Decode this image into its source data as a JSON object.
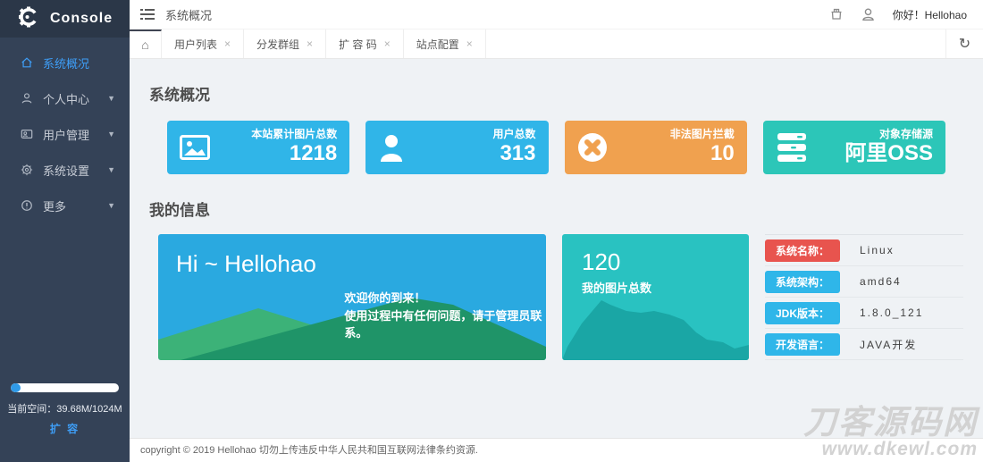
{
  "app": {
    "logo_text": "Console"
  },
  "header": {
    "breadcrumb": "系统概况",
    "greeting": "你好！Hellohao"
  },
  "sidebar": {
    "items": [
      {
        "label": "系统概况",
        "active": true
      },
      {
        "label": "个人中心",
        "active": false
      },
      {
        "label": "用户管理",
        "active": false
      },
      {
        "label": "系统设置",
        "active": false
      },
      {
        "label": "更多",
        "active": false
      }
    ],
    "caret_glyph": "▼",
    "storage": {
      "label": "当前空间：",
      "value": "39.68M/1024M",
      "expand_link": "扩 容",
      "used_percent": 9
    }
  },
  "tabs": {
    "close_glyph": "×",
    "refresh_glyph": "↻",
    "home_glyph": "⌂",
    "items": [
      {
        "label": "用户列表"
      },
      {
        "label": "分发群组"
      },
      {
        "label": "扩 容 码"
      },
      {
        "label": "站点配置"
      }
    ]
  },
  "overview": {
    "title": "系统概况",
    "cards": [
      {
        "label": "本站累计图片总数",
        "value": "1218",
        "color": "#30b5e8",
        "icon": "photo-icon"
      },
      {
        "label": "用户总数",
        "value": "313",
        "color": "#30b5e8",
        "icon": "user-icon"
      },
      {
        "label": "非法图片拦截",
        "value": "10",
        "color": "#f0a14f",
        "icon": "block-icon"
      },
      {
        "label": "对象存储源",
        "value": "阿里OSS",
        "color": "#2cc6b8",
        "icon": "server-icon"
      }
    ]
  },
  "myinfo": {
    "title": "我的信息",
    "banner": {
      "greeting": "Hi ~ Hellohao",
      "line1": "欢迎你的到来！",
      "line2": "使用过程中有任何问题，请于管理员联系。"
    },
    "photo_card": {
      "value": "120",
      "label": "我的图片总数"
    },
    "system_rows": [
      {
        "label": "系统名称：",
        "value": "Linux",
        "color": "#e8544e"
      },
      {
        "label": "系统架构：",
        "value": "amd64",
        "color": "#2fb6e9"
      },
      {
        "label": "JDK版本：",
        "value": "1.8.0_121",
        "color": "#2fb6e9"
      },
      {
        "label": "开发语言：",
        "value": "JAVA开发",
        "color": "#2fb6e9"
      }
    ]
  },
  "footer": {
    "copyright": "copyright © 2019 Hellohao 切勿上传违反中华人民共和国互联网法律条约资源."
  },
  "watermark": {
    "line1": "刀客源码网",
    "line2": "www.dkewl.com"
  },
  "colors": {
    "sidebar_bg": "#344257",
    "logo_bg": "#2b3748",
    "active_link": "#3e9ef7",
    "card_blue": "#30b5e8",
    "card_orange": "#f0a14f",
    "card_teal": "#2cc6b8",
    "banner_blue": "#2aa9e0",
    "photo_card_teal": "#29c2c1",
    "button_red": "#e8544e",
    "button_blue": "#2fb6e9"
  }
}
